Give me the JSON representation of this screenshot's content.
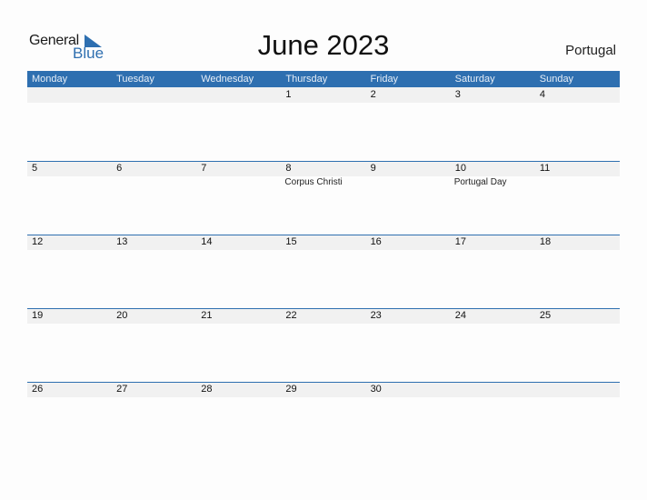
{
  "logo": {
    "line1": "General",
    "line2": "Blue",
    "accent": "#2e6fb0"
  },
  "title": "June 2023",
  "country": "Portugal",
  "weekdays": [
    "Monday",
    "Tuesday",
    "Wednesday",
    "Thursday",
    "Friday",
    "Saturday",
    "Sunday"
  ],
  "weeks": [
    {
      "days": [
        {
          "d": ""
        },
        {
          "d": ""
        },
        {
          "d": ""
        },
        {
          "d": "1"
        },
        {
          "d": "2"
        },
        {
          "d": "3"
        },
        {
          "d": "4"
        }
      ]
    },
    {
      "days": [
        {
          "d": "5"
        },
        {
          "d": "6"
        },
        {
          "d": "7"
        },
        {
          "d": "8",
          "holiday": "Corpus Christi"
        },
        {
          "d": "9"
        },
        {
          "d": "10",
          "holiday": "Portugal Day"
        },
        {
          "d": "11"
        }
      ]
    },
    {
      "days": [
        {
          "d": "12"
        },
        {
          "d": "13"
        },
        {
          "d": "14"
        },
        {
          "d": "15"
        },
        {
          "d": "16"
        },
        {
          "d": "17"
        },
        {
          "d": "18"
        }
      ]
    },
    {
      "days": [
        {
          "d": "19"
        },
        {
          "d": "20"
        },
        {
          "d": "21"
        },
        {
          "d": "22"
        },
        {
          "d": "23"
        },
        {
          "d": "24"
        },
        {
          "d": "25"
        }
      ]
    },
    {
      "days": [
        {
          "d": "26"
        },
        {
          "d": "27"
        },
        {
          "d": "28"
        },
        {
          "d": "29"
        },
        {
          "d": "30"
        },
        {
          "d": ""
        },
        {
          "d": ""
        }
      ]
    }
  ]
}
